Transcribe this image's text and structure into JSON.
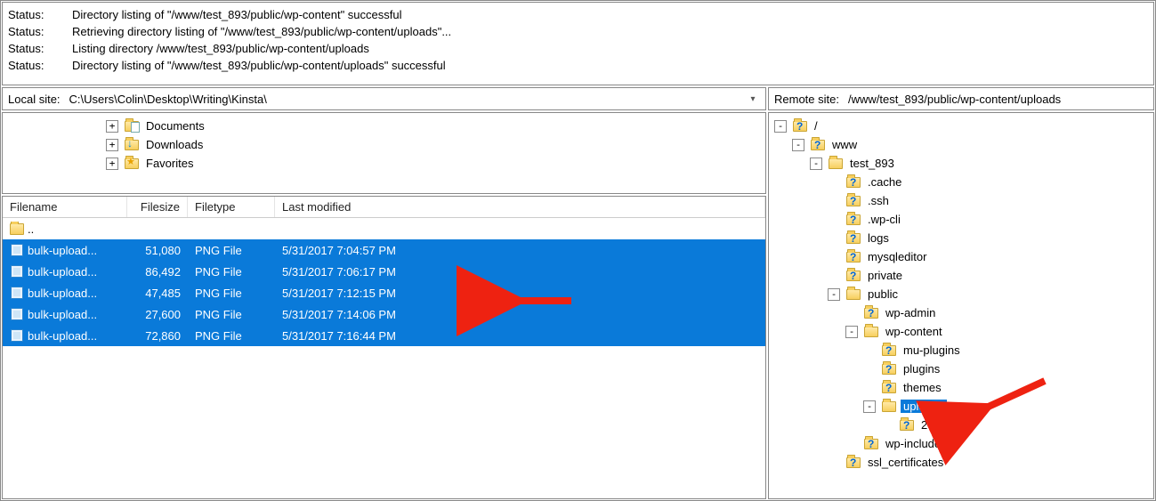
{
  "status": [
    {
      "k": "Status:",
      "m": "Directory listing of \"/www/test_893/public/wp-content\" successful"
    },
    {
      "k": "Status:",
      "m": "Retrieving directory listing of \"/www/test_893/public/wp-content/uploads\"..."
    },
    {
      "k": "Status:",
      "m": "Listing directory /www/test_893/public/wp-content/uploads"
    },
    {
      "k": "Status:",
      "m": "Directory listing of \"/www/test_893/public/wp-content/uploads\" successful"
    }
  ],
  "local": {
    "label": "Local site:",
    "path": "C:\\Users\\Colin\\Desktop\\Writing\\Kinsta\\",
    "tree": [
      {
        "indent": 110,
        "twist": "+",
        "icon": "doc",
        "name": "Documents"
      },
      {
        "indent": 110,
        "twist": "+",
        "icon": "dl",
        "name": "Downloads"
      },
      {
        "indent": 110,
        "twist": "+",
        "icon": "fav",
        "name": "Favorites"
      }
    ],
    "cols": {
      "name": "Filename",
      "size": "Filesize",
      "type": "Filetype",
      "mod": "Last modified"
    },
    "parent": "..",
    "files": [
      {
        "name": "bulk-upload...",
        "size": "51,080",
        "type": "PNG File",
        "mod": "5/31/2017 7:04:57 PM"
      },
      {
        "name": "bulk-upload...",
        "size": "86,492",
        "type": "PNG File",
        "mod": "5/31/2017 7:06:17 PM"
      },
      {
        "name": "bulk-upload...",
        "size": "47,485",
        "type": "PNG File",
        "mod": "5/31/2017 7:12:15 PM"
      },
      {
        "name": "bulk-upload...",
        "size": "27,600",
        "type": "PNG File",
        "mod": "5/31/2017 7:14:06 PM"
      },
      {
        "name": "bulk-upload...",
        "size": "72,860",
        "type": "PNG File",
        "mod": "5/31/2017 7:16:44 PM"
      }
    ]
  },
  "remote": {
    "label": "Remote site:",
    "path": "/www/test_893/public/wp-content/uploads",
    "tree": [
      {
        "indent": 0,
        "twist": "-",
        "icon": "q",
        "name": "/"
      },
      {
        "indent": 20,
        "twist": "-",
        "icon": "q",
        "name": "www"
      },
      {
        "indent": 40,
        "twist": "-",
        "icon": "folder",
        "name": "test_893"
      },
      {
        "indent": 60,
        "twist": " ",
        "icon": "q",
        "name": ".cache"
      },
      {
        "indent": 60,
        "twist": " ",
        "icon": "q",
        "name": ".ssh"
      },
      {
        "indent": 60,
        "twist": " ",
        "icon": "q",
        "name": ".wp-cli"
      },
      {
        "indent": 60,
        "twist": " ",
        "icon": "q",
        "name": "logs"
      },
      {
        "indent": 60,
        "twist": " ",
        "icon": "q",
        "name": "mysqleditor"
      },
      {
        "indent": 60,
        "twist": " ",
        "icon": "q",
        "name": "private"
      },
      {
        "indent": 60,
        "twist": "-",
        "icon": "folder",
        "name": "public"
      },
      {
        "indent": 80,
        "twist": " ",
        "icon": "q",
        "name": "wp-admin"
      },
      {
        "indent": 80,
        "twist": "-",
        "icon": "folder",
        "name": "wp-content"
      },
      {
        "indent": 100,
        "twist": " ",
        "icon": "q",
        "name": "mu-plugins"
      },
      {
        "indent": 100,
        "twist": " ",
        "icon": "q",
        "name": "plugins"
      },
      {
        "indent": 100,
        "twist": " ",
        "icon": "q",
        "name": "themes"
      },
      {
        "indent": 100,
        "twist": "-",
        "icon": "folder",
        "name": "uploads",
        "sel": true
      },
      {
        "indent": 120,
        "twist": " ",
        "icon": "q",
        "name": "2017"
      },
      {
        "indent": 80,
        "twist": " ",
        "icon": "q",
        "name": "wp-includes"
      },
      {
        "indent": 60,
        "twist": " ",
        "icon": "q",
        "name": "ssl_certificates"
      }
    ]
  }
}
